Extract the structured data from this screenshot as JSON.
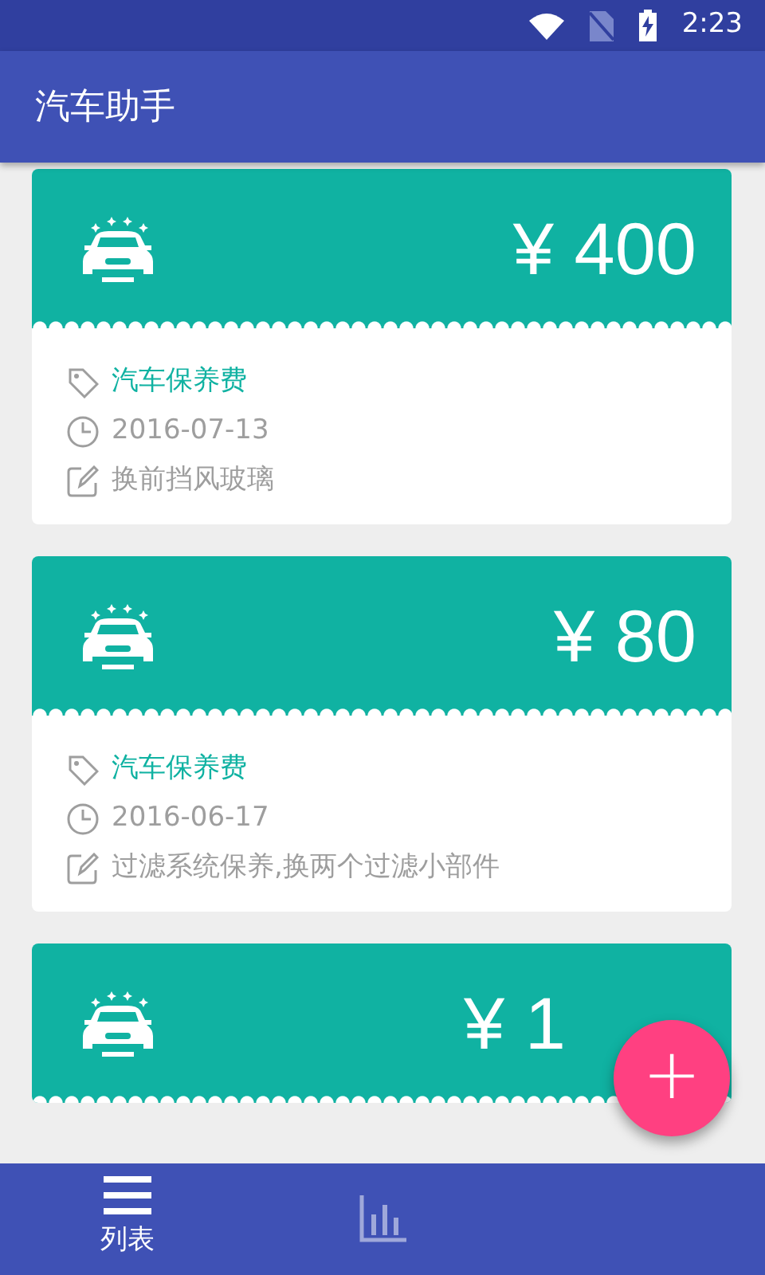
{
  "status_bar": {
    "time": "2:23"
  },
  "app_bar": {
    "title": "汽车助手"
  },
  "cards": [
    {
      "amount": "¥ 400",
      "category": "汽车保养费",
      "date": "2016-07-13",
      "note": "换前挡风玻璃"
    },
    {
      "amount": "¥ 80",
      "category": "汽车保养费",
      "date": "2016-06-17",
      "note": "过滤系统保养,换两个过滤小部件"
    },
    {
      "amount": "¥ 1"
    }
  ],
  "fab": {
    "label": "+"
  },
  "bottom_nav": [
    {
      "kind": "list",
      "label": "列表",
      "selected": true
    },
    {
      "kind": "chart",
      "selected": false
    }
  ]
}
